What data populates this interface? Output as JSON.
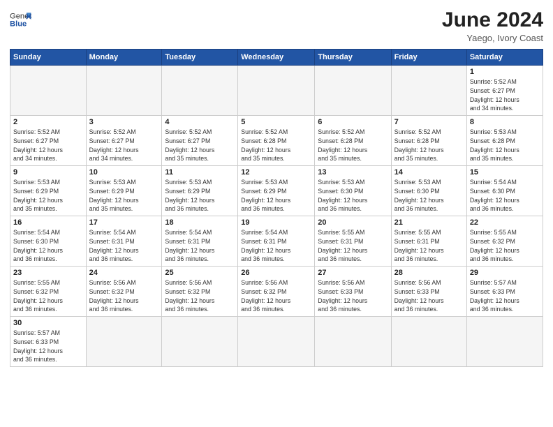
{
  "header": {
    "logo_general": "General",
    "logo_blue": "Blue",
    "month": "June 2024",
    "location": "Yaego, Ivory Coast"
  },
  "weekdays": [
    "Sunday",
    "Monday",
    "Tuesday",
    "Wednesday",
    "Thursday",
    "Friday",
    "Saturday"
  ],
  "weeks": [
    [
      {
        "day": "",
        "info": ""
      },
      {
        "day": "",
        "info": ""
      },
      {
        "day": "",
        "info": ""
      },
      {
        "day": "",
        "info": ""
      },
      {
        "day": "",
        "info": ""
      },
      {
        "day": "",
        "info": ""
      },
      {
        "day": "1",
        "info": "Sunrise: 5:52 AM\nSunset: 6:27 PM\nDaylight: 12 hours\nand 34 minutes."
      }
    ],
    [
      {
        "day": "2",
        "info": "Sunrise: 5:52 AM\nSunset: 6:27 PM\nDaylight: 12 hours\nand 34 minutes."
      },
      {
        "day": "3",
        "info": "Sunrise: 5:52 AM\nSunset: 6:27 PM\nDaylight: 12 hours\nand 34 minutes."
      },
      {
        "day": "4",
        "info": "Sunrise: 5:52 AM\nSunset: 6:27 PM\nDaylight: 12 hours\nand 35 minutes."
      },
      {
        "day": "5",
        "info": "Sunrise: 5:52 AM\nSunset: 6:28 PM\nDaylight: 12 hours\nand 35 minutes."
      },
      {
        "day": "6",
        "info": "Sunrise: 5:52 AM\nSunset: 6:28 PM\nDaylight: 12 hours\nand 35 minutes."
      },
      {
        "day": "7",
        "info": "Sunrise: 5:52 AM\nSunset: 6:28 PM\nDaylight: 12 hours\nand 35 minutes."
      },
      {
        "day": "8",
        "info": "Sunrise: 5:53 AM\nSunset: 6:28 PM\nDaylight: 12 hours\nand 35 minutes."
      }
    ],
    [
      {
        "day": "9",
        "info": "Sunrise: 5:53 AM\nSunset: 6:29 PM\nDaylight: 12 hours\nand 35 minutes."
      },
      {
        "day": "10",
        "info": "Sunrise: 5:53 AM\nSunset: 6:29 PM\nDaylight: 12 hours\nand 35 minutes."
      },
      {
        "day": "11",
        "info": "Sunrise: 5:53 AM\nSunset: 6:29 PM\nDaylight: 12 hours\nand 36 minutes."
      },
      {
        "day": "12",
        "info": "Sunrise: 5:53 AM\nSunset: 6:29 PM\nDaylight: 12 hours\nand 36 minutes."
      },
      {
        "day": "13",
        "info": "Sunrise: 5:53 AM\nSunset: 6:30 PM\nDaylight: 12 hours\nand 36 minutes."
      },
      {
        "day": "14",
        "info": "Sunrise: 5:53 AM\nSunset: 6:30 PM\nDaylight: 12 hours\nand 36 minutes."
      },
      {
        "day": "15",
        "info": "Sunrise: 5:54 AM\nSunset: 6:30 PM\nDaylight: 12 hours\nand 36 minutes."
      }
    ],
    [
      {
        "day": "16",
        "info": "Sunrise: 5:54 AM\nSunset: 6:30 PM\nDaylight: 12 hours\nand 36 minutes."
      },
      {
        "day": "17",
        "info": "Sunrise: 5:54 AM\nSunset: 6:31 PM\nDaylight: 12 hours\nand 36 minutes."
      },
      {
        "day": "18",
        "info": "Sunrise: 5:54 AM\nSunset: 6:31 PM\nDaylight: 12 hours\nand 36 minutes."
      },
      {
        "day": "19",
        "info": "Sunrise: 5:54 AM\nSunset: 6:31 PM\nDaylight: 12 hours\nand 36 minutes."
      },
      {
        "day": "20",
        "info": "Sunrise: 5:55 AM\nSunset: 6:31 PM\nDaylight: 12 hours\nand 36 minutes."
      },
      {
        "day": "21",
        "info": "Sunrise: 5:55 AM\nSunset: 6:31 PM\nDaylight: 12 hours\nand 36 minutes."
      },
      {
        "day": "22",
        "info": "Sunrise: 5:55 AM\nSunset: 6:32 PM\nDaylight: 12 hours\nand 36 minutes."
      }
    ],
    [
      {
        "day": "23",
        "info": "Sunrise: 5:55 AM\nSunset: 6:32 PM\nDaylight: 12 hours\nand 36 minutes."
      },
      {
        "day": "24",
        "info": "Sunrise: 5:56 AM\nSunset: 6:32 PM\nDaylight: 12 hours\nand 36 minutes."
      },
      {
        "day": "25",
        "info": "Sunrise: 5:56 AM\nSunset: 6:32 PM\nDaylight: 12 hours\nand 36 minutes."
      },
      {
        "day": "26",
        "info": "Sunrise: 5:56 AM\nSunset: 6:32 PM\nDaylight: 12 hours\nand 36 minutes."
      },
      {
        "day": "27",
        "info": "Sunrise: 5:56 AM\nSunset: 6:33 PM\nDaylight: 12 hours\nand 36 minutes."
      },
      {
        "day": "28",
        "info": "Sunrise: 5:56 AM\nSunset: 6:33 PM\nDaylight: 12 hours\nand 36 minutes."
      },
      {
        "day": "29",
        "info": "Sunrise: 5:57 AM\nSunset: 6:33 PM\nDaylight: 12 hours\nand 36 minutes."
      }
    ],
    [
      {
        "day": "30",
        "info": "Sunrise: 5:57 AM\nSunset: 6:33 PM\nDaylight: 12 hours\nand 36 minutes."
      },
      {
        "day": "",
        "info": ""
      },
      {
        "day": "",
        "info": ""
      },
      {
        "day": "",
        "info": ""
      },
      {
        "day": "",
        "info": ""
      },
      {
        "day": "",
        "info": ""
      },
      {
        "day": "",
        "info": ""
      }
    ]
  ]
}
